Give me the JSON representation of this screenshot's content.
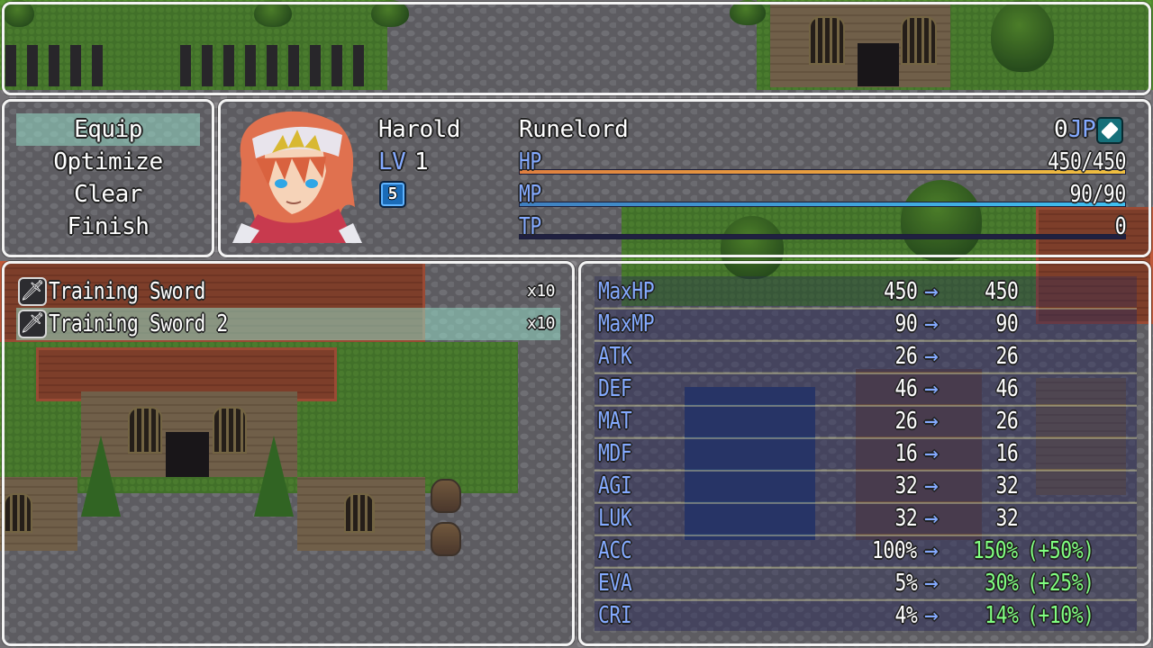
{
  "command_menu": {
    "items": [
      {
        "label": "Equip",
        "selected": true
      },
      {
        "label": "Optimize",
        "selected": false
      },
      {
        "label": "Clear",
        "selected": false
      },
      {
        "label": "Finish",
        "selected": false
      }
    ]
  },
  "actor": {
    "name": "Harold",
    "level_label": "LV",
    "level": "1",
    "class": "Runelord",
    "job_points": "0",
    "job_points_label": "JP",
    "badge_number": "5",
    "hp_label": "HP",
    "hp_value": "450/450",
    "hp_fraction": 1.0,
    "mp_label": "MP",
    "mp_value": "90/90",
    "mp_fraction": 1.0,
    "tp_label": "TP",
    "tp_value": "0",
    "tp_fraction": 0.0
  },
  "item_list": {
    "items": [
      {
        "icon": "sword-icon",
        "name": "Training Sword",
        "count": "x10",
        "selected": false
      },
      {
        "icon": "sword-icon",
        "name": "Training Sword 2",
        "count": "x10",
        "selected": true
      }
    ]
  },
  "stats": {
    "arrow": "→",
    "rows": [
      {
        "name": "MaxHP",
        "current": "450",
        "new": "450",
        "diff": ""
      },
      {
        "name": "MaxMP",
        "current": "90",
        "new": "90",
        "diff": ""
      },
      {
        "name": "ATK",
        "current": "26",
        "new": "26",
        "diff": ""
      },
      {
        "name": "DEF",
        "current": "46",
        "new": "46",
        "diff": ""
      },
      {
        "name": "MAT",
        "current": "26",
        "new": "26",
        "diff": ""
      },
      {
        "name": "MDF",
        "current": "16",
        "new": "16",
        "diff": ""
      },
      {
        "name": "AGI",
        "current": "32",
        "new": "32",
        "diff": ""
      },
      {
        "name": "LUK",
        "current": "32",
        "new": "32",
        "diff": ""
      },
      {
        "name": "ACC",
        "current": "100%",
        "new": "150%",
        "diff": "(+50%)"
      },
      {
        "name": "EVA",
        "current": "5%",
        "new": "30%",
        "diff": "(+25%)"
      },
      {
        "name": "CRI",
        "current": "4%",
        "new": "14%",
        "diff": "(+10%)"
      }
    ]
  },
  "colors": {
    "system_text": "#84aaff",
    "power_up_text": "#80ff80",
    "normal_text": "#ffffff",
    "hp_gauge": [
      "#e08040",
      "#f0c040"
    ],
    "mp_gauge": [
      "#4080c0",
      "#40c0f0"
    ],
    "cursor": "#96dcc8"
  }
}
